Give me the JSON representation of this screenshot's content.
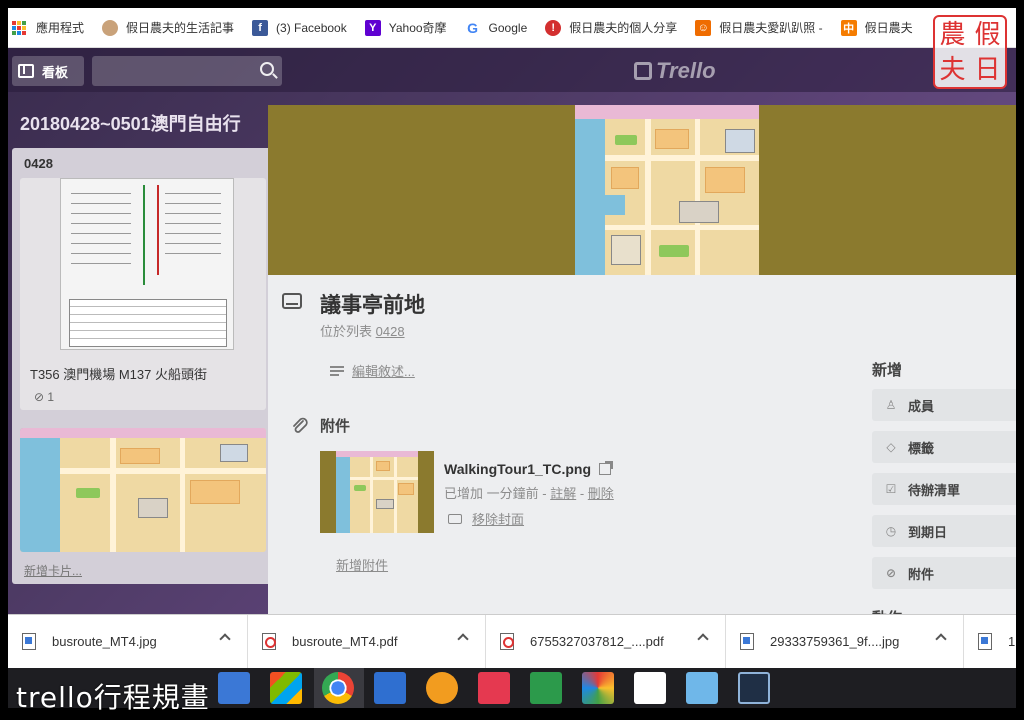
{
  "bookmarks": [
    {
      "label": "應用程式",
      "icon": "apps-icon"
    },
    {
      "label": "假日農夫的生活記事",
      "icon": "avatar-icon"
    },
    {
      "label": "(3) Facebook",
      "icon": "facebook-icon"
    },
    {
      "label": "Yahoo奇摩",
      "icon": "yahoo-icon"
    },
    {
      "label": "Google",
      "icon": "google-icon"
    },
    {
      "label": "假日農夫的個人分享",
      "icon": "pin-icon"
    },
    {
      "label": "假日農夫愛趴趴照 -",
      "icon": "blog-icon"
    },
    {
      "label": "假日農夫",
      "icon": "zhong-icon"
    }
  ],
  "header": {
    "board_button": "看板",
    "logo": "Trello"
  },
  "board": {
    "title": "20180428~0501澳門自由行",
    "list": {
      "title": "0428",
      "card1_title": "T356 澳門機場 M137 火船頭街",
      "card1_attachments": "1",
      "add_card": "新增卡片..."
    }
  },
  "card": {
    "title": "議事亭前地",
    "in_list_prefix": "位於列表",
    "in_list_name": "0428",
    "edit_description": "編輯敘述...",
    "attachments_heading": "附件",
    "attachment": {
      "name": "WalkingTour1_TC.png",
      "added": "已增加 一分鐘前 -",
      "comment": "註解",
      "sep": "-",
      "delete": "刪除",
      "remove_cover": "移除封面"
    },
    "add_attachment": "新增附件"
  },
  "sidebar": {
    "add_heading": "新增",
    "buttons": [
      {
        "label": "成員",
        "icon": "member-icon"
      },
      {
        "label": "標籤",
        "icon": "label-icon"
      },
      {
        "label": "待辦清單",
        "icon": "checklist-icon"
      },
      {
        "label": "到期日",
        "icon": "clock-icon"
      },
      {
        "label": "附件",
        "icon": "paperclip-icon"
      }
    ],
    "actions_heading": "動作"
  },
  "downloads": [
    {
      "name": "busroute_MT4.jpg",
      "type": "img"
    },
    {
      "name": "busroute_MT4.pdf",
      "type": "pdf"
    },
    {
      "name": "6755327037812_....pdf",
      "type": "pdf"
    },
    {
      "name": "29333759361_9f....jpg",
      "type": "img"
    },
    {
      "name": "1",
      "type": "img"
    }
  ],
  "seal": [
    "農",
    "假",
    "夫",
    "日"
  ],
  "watermark": "trello行程規畫",
  "colors": {
    "trello_bg": "#4d3a64",
    "cover_bg": "#8b7a2e",
    "modal_bg": "#edeef0",
    "seal_red": "#dd3333",
    "taskbar": "#1e1e22"
  }
}
